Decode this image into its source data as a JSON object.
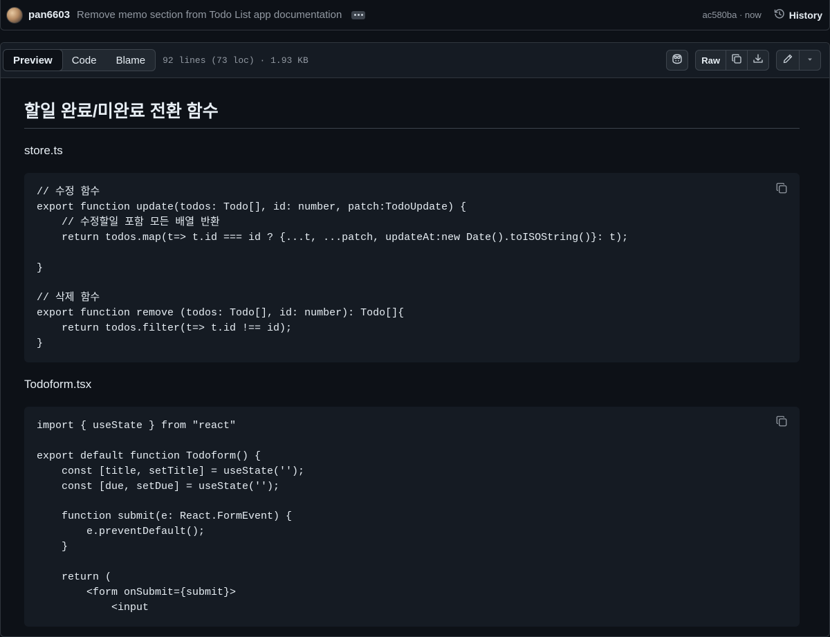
{
  "commit": {
    "author": "pan6603",
    "message": "Remove memo section from Todo List app documentation",
    "meta": "ac580ba · now",
    "history_label": "History"
  },
  "file_header": {
    "tabs": [
      {
        "label": "Preview",
        "active": true
      },
      {
        "label": "Code",
        "active": false
      },
      {
        "label": "Blame",
        "active": false
      }
    ],
    "info": "92 lines (73 loc) · 1.93 KB",
    "raw_label": "Raw"
  },
  "content": {
    "heading": "할일 완료/미완료 전환 함수",
    "sections": [
      {
        "file_name": "store.ts",
        "code": "// 수정 함수\nexport function update(todos: Todo[], id: number, patch:TodoUpdate) {\n    // 수정할일 포함 모든 배열 반환\n    return todos.map(t=> t.id === id ? {...t, ...patch, updateAt:new Date().toISOString()}: t);\n\n}\n\n// 삭제 함수\nexport function remove (todos: Todo[], id: number): Todo[]{\n    return todos.filter(t=> t.id !== id);\n}"
      },
      {
        "file_name": "Todoform.tsx",
        "code": "import { useState } from \"react\"\n\nexport default function Todoform() {\n    const [title, setTitle] = useState('');\n    const [due, setDue] = useState('');\n\n    function submit(e: React.FormEvent) {\n        e.preventDefault();\n    }\n\n    return (\n        <form onSubmit={submit}>\n            <input"
      }
    ]
  }
}
